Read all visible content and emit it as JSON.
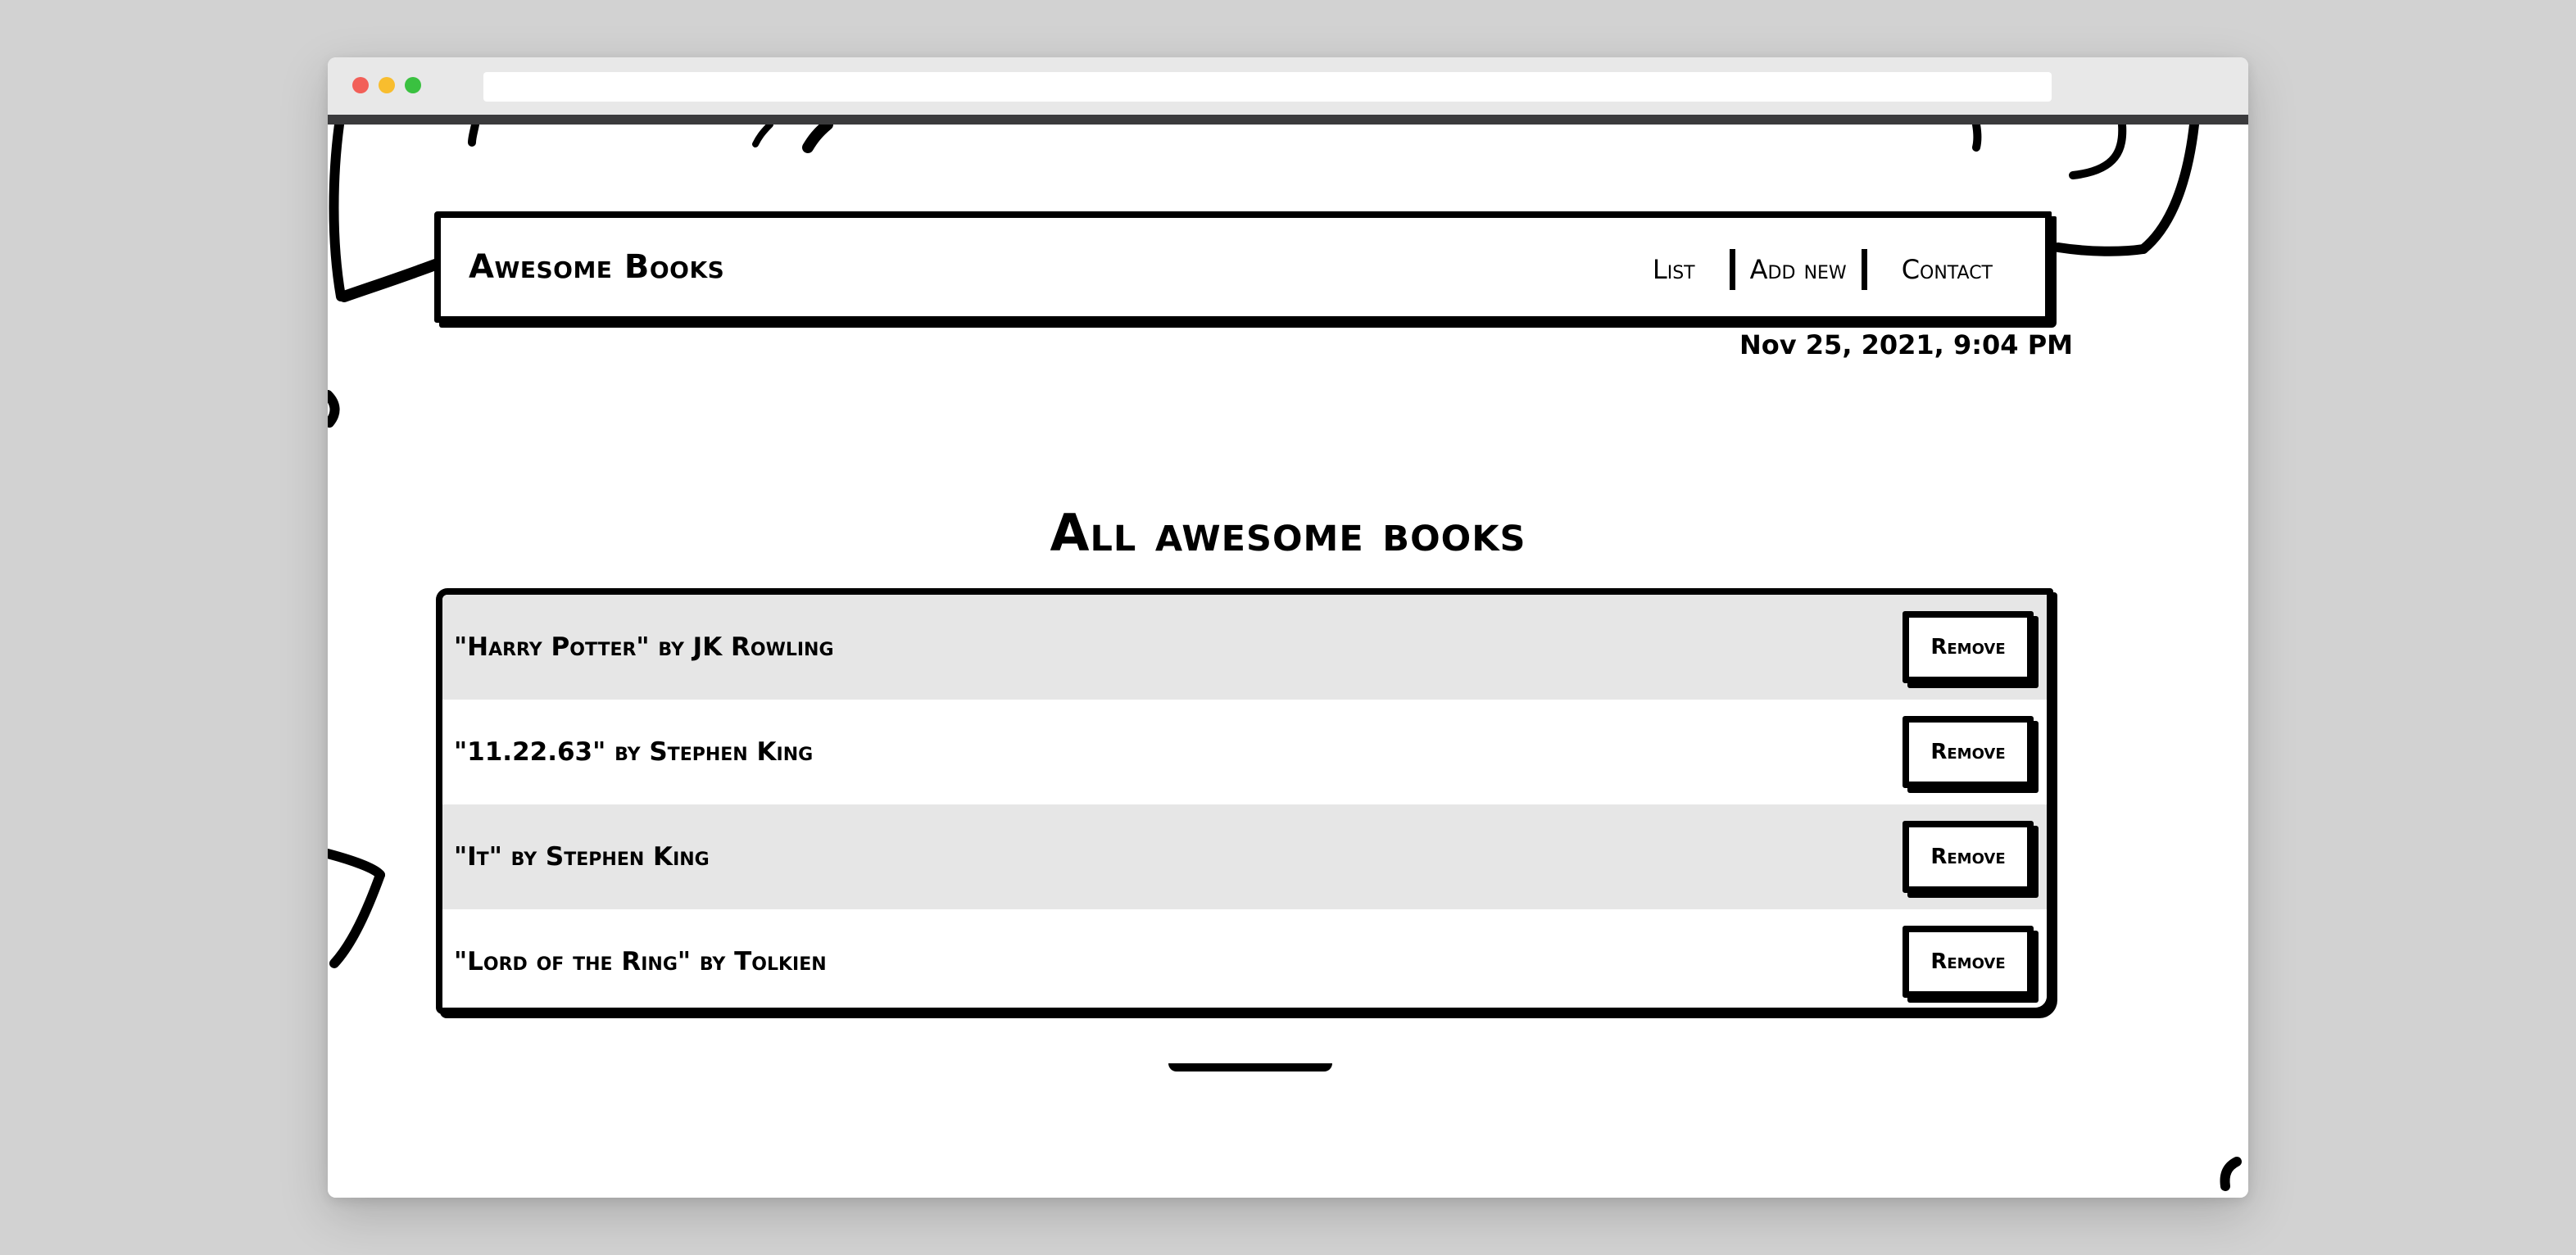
{
  "app": {
    "brand": "Awesome Books"
  },
  "nav": {
    "items": [
      {
        "label": "List"
      },
      {
        "label": "Add new"
      },
      {
        "label": "Contact"
      }
    ]
  },
  "timestamp": "Nov 25, 2021, 9:04 PM",
  "main": {
    "title": "All awesome books",
    "books": [
      {
        "text": "\"Harry Potter\" by JK Rowling",
        "remove_label": "Remove"
      },
      {
        "text": "\"11.22.63\" by Stephen King",
        "remove_label": "Remove"
      },
      {
        "text": "\"It\" by Stephen King",
        "remove_label": "Remove"
      },
      {
        "text": "\"Lord of the Ring\" by Tolkien",
        "remove_label": "Remove"
      }
    ]
  },
  "colors": {
    "ink": "#000000",
    "row_alt": "#e6e6e6",
    "page_bg": "#d2d2d2"
  }
}
